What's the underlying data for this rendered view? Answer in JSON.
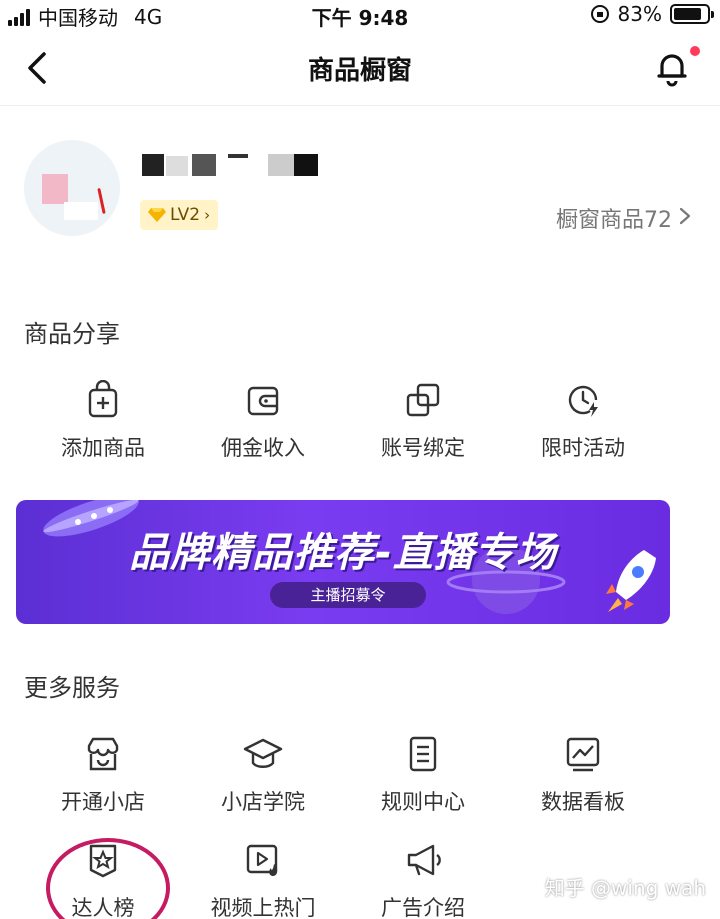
{
  "status_bar": {
    "carrier": "中国移动",
    "network": "4G",
    "time": "下午 9:48",
    "battery": "83%",
    "battery_level": 0.83
  },
  "nav": {
    "title": "商品橱窗",
    "back_icon": "chevron-left-icon",
    "bell_icon": "bell-icon",
    "has_notification": true
  },
  "profile": {
    "level": "LV2",
    "level_icon": "diamond-icon",
    "shelf_label": "橱窗商品72"
  },
  "product_sharing": {
    "title": "商品分享",
    "items": [
      {
        "label": "添加商品",
        "icon": "bag-plus-icon"
      },
      {
        "label": "佣金收入",
        "icon": "wallet-icon"
      },
      {
        "label": "账号绑定",
        "icon": "link-squares-icon"
      },
      {
        "label": "限时活动",
        "icon": "clock-lightning-icon"
      }
    ]
  },
  "banner": {
    "title": "品牌精品推荐-直播专场",
    "subtitle": "主播招募令"
  },
  "more_services": {
    "title": "更多服务",
    "items": [
      {
        "label": "开通小店",
        "icon": "store-icon"
      },
      {
        "label": "小店学院",
        "icon": "graduation-cap-icon"
      },
      {
        "label": "规则中心",
        "icon": "document-icon"
      },
      {
        "label": "数据看板",
        "icon": "chart-board-icon"
      },
      {
        "label": "达人榜",
        "icon": "star-badge-icon"
      },
      {
        "label": "视频上热门",
        "icon": "video-fire-icon"
      },
      {
        "label": "广告介绍",
        "icon": "megaphone-icon"
      }
    ]
  },
  "watermark": "知乎 @wing wah",
  "colors": {
    "accent_red": "#ff3b5c",
    "banner_purple": "#6a2ce0",
    "badge_yellow": "#fff3c7",
    "highlight_circle": "#c51b63"
  }
}
